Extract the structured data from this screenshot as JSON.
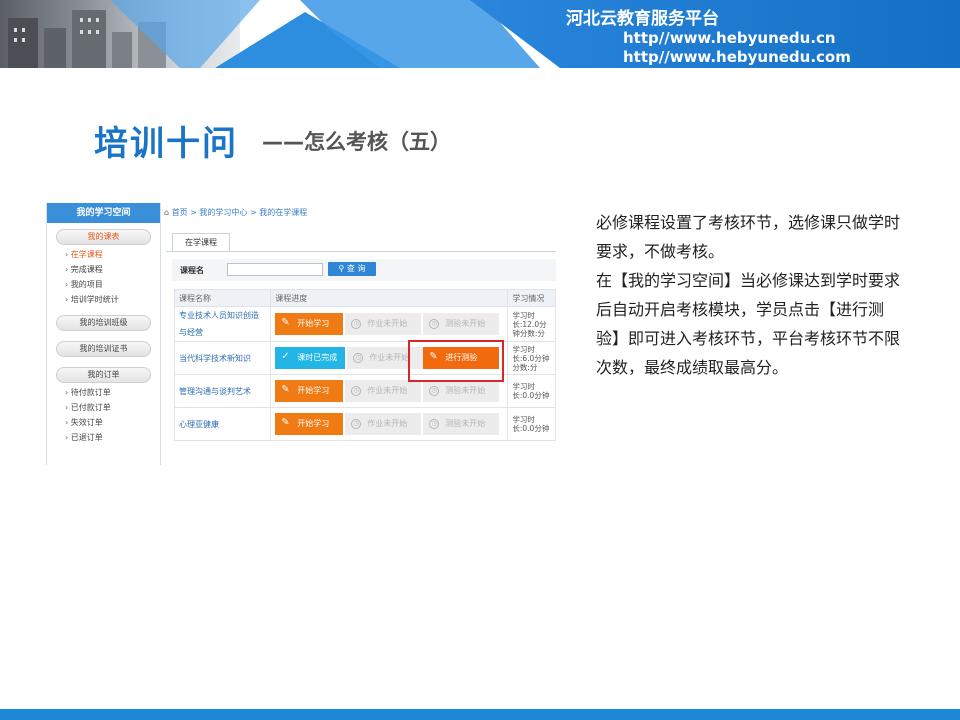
{
  "header": {
    "platform_name": "河北云教育服务平台",
    "urls": [
      "http//www.hebyunedu.cn",
      "http//www.hebyunedu.com"
    ]
  },
  "slide": {
    "title": "培训十问",
    "subtitle": "——怎么考核（五）"
  },
  "sidebar": {
    "heading": "我的学习空间",
    "groups": [
      {
        "label": "我的课表",
        "active": true,
        "items": [
          {
            "label": "在学课程",
            "active": true
          },
          {
            "label": "完成课程",
            "active": false
          },
          {
            "label": "我的项目",
            "active": false
          },
          {
            "label": "培训学时统计",
            "active": false
          }
        ]
      },
      {
        "label": "我的培训班级",
        "active": false,
        "items": []
      },
      {
        "label": "我的培训证书",
        "active": false,
        "items": []
      },
      {
        "label": "我的订单",
        "active": false,
        "items": [
          {
            "label": "待付款订单",
            "active": false
          },
          {
            "label": "已付款订单",
            "active": false
          },
          {
            "label": "失效订单",
            "active": false
          },
          {
            "label": "已退订单",
            "active": false
          }
        ]
      }
    ]
  },
  "breadcrumb": [
    "首页",
    "我的学习中心",
    "我的在学课程"
  ],
  "tab_label": "在学课程",
  "search": {
    "label": "课程名",
    "button": "查 询"
  },
  "table": {
    "headers": [
      "课程名称",
      "课程进度",
      "学习情况"
    ],
    "rows": [
      {
        "name": "专业技术人员知识创造与经营",
        "steps": [
          "开始学习",
          "作业未开始",
          "测验未开始"
        ],
        "first": "start",
        "info": "学习时长:12.0分钟分数:分"
      },
      {
        "name": "当代科学技术新知识",
        "steps": [
          "课时已完成",
          "作业未开始",
          "进行测验"
        ],
        "first": "done",
        "info": "学习时长:6.0分钟分数:分"
      },
      {
        "name": "管理沟通与谈判艺术",
        "steps": [
          "开始学习",
          "作业未开始",
          "测验未开始"
        ],
        "first": "start",
        "info": "学习时长:0.0分钟"
      },
      {
        "name": "心理亚健康",
        "steps": [
          "开始学习",
          "作业未开始",
          "测验未开始"
        ],
        "first": "start",
        "info": "学习时长:0.0分钟"
      }
    ]
  },
  "description": [
    "必修课程设置了考核环节，选修课只做学时要求，不做考核。",
    "在【我的学习空间】当必修课达到学时要求后自动开启考核模块，学员点击【进行测验】即可进入考核环节，平台考核环节不限次数，最终成绩取最高分。"
  ],
  "colors": {
    "brand_blue": "#1a74c8",
    "accent_orange": "#f07a13",
    "done_cyan": "#22b5e6",
    "highlight_red": "#d9262d"
  }
}
